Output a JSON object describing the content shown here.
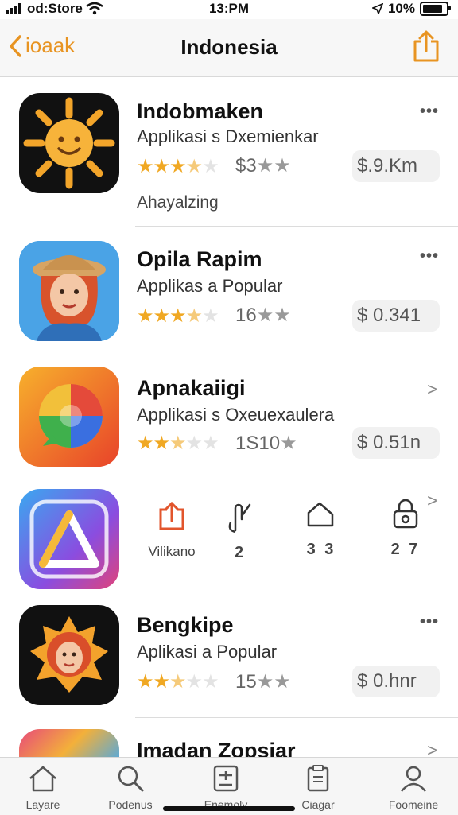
{
  "status": {
    "carrier": "od:Store",
    "time": "13:PM",
    "battery": "10%"
  },
  "nav": {
    "back_label": "ioaak",
    "title": "Indonesia"
  },
  "apps": [
    {
      "name": "Indobmaken",
      "subtitle": "Applikasi s Dxemienkar",
      "rating": 3.5,
      "count": "$3",
      "price": "$.9.Km",
      "extra": "Ahayalzing",
      "trailing": "more"
    },
    {
      "name": "Opila  Rapim",
      "subtitle": "Applikas a Popular",
      "rating": 3.5,
      "count": "16",
      "price": "$ 0.341",
      "trailing": "more"
    },
    {
      "name": "Apnakaiigi",
      "subtitle": "Applikasi s Oxeuexaulera",
      "rating": 2.5,
      "count": "1S10",
      "price": "$ 0.51n",
      "trailing": "chevron"
    },
    {
      "action_buttons": [
        {
          "icon": "share-icon",
          "label": "Vilikano",
          "active": true
        },
        {
          "icon": "touch-icon",
          "label": "2"
        },
        {
          "icon": "tag-icon",
          "label": "3 3"
        },
        {
          "icon": "lock-icon",
          "label": "2 7"
        }
      ],
      "trailing": "chevron"
    },
    {
      "name": "Bengkipe",
      "subtitle": "Aplikasi a Popular",
      "rating": 2.5,
      "count": "15",
      "price": "$ 0.hnr",
      "trailing": "more"
    },
    {
      "name": "Imadan Zopsiar",
      "trailing": "chevron"
    }
  ],
  "tabs": [
    {
      "icon": "home-icon",
      "label": "Layare"
    },
    {
      "icon": "search-icon",
      "label": "Podenus"
    },
    {
      "icon": "calculator-icon",
      "label": "Enemoly"
    },
    {
      "icon": "clipboard-icon",
      "label": "Ciagar"
    },
    {
      "icon": "person-icon",
      "label": "Foomeine"
    }
  ],
  "colors": {
    "accent": "#e89422",
    "star": "#f0a823"
  }
}
